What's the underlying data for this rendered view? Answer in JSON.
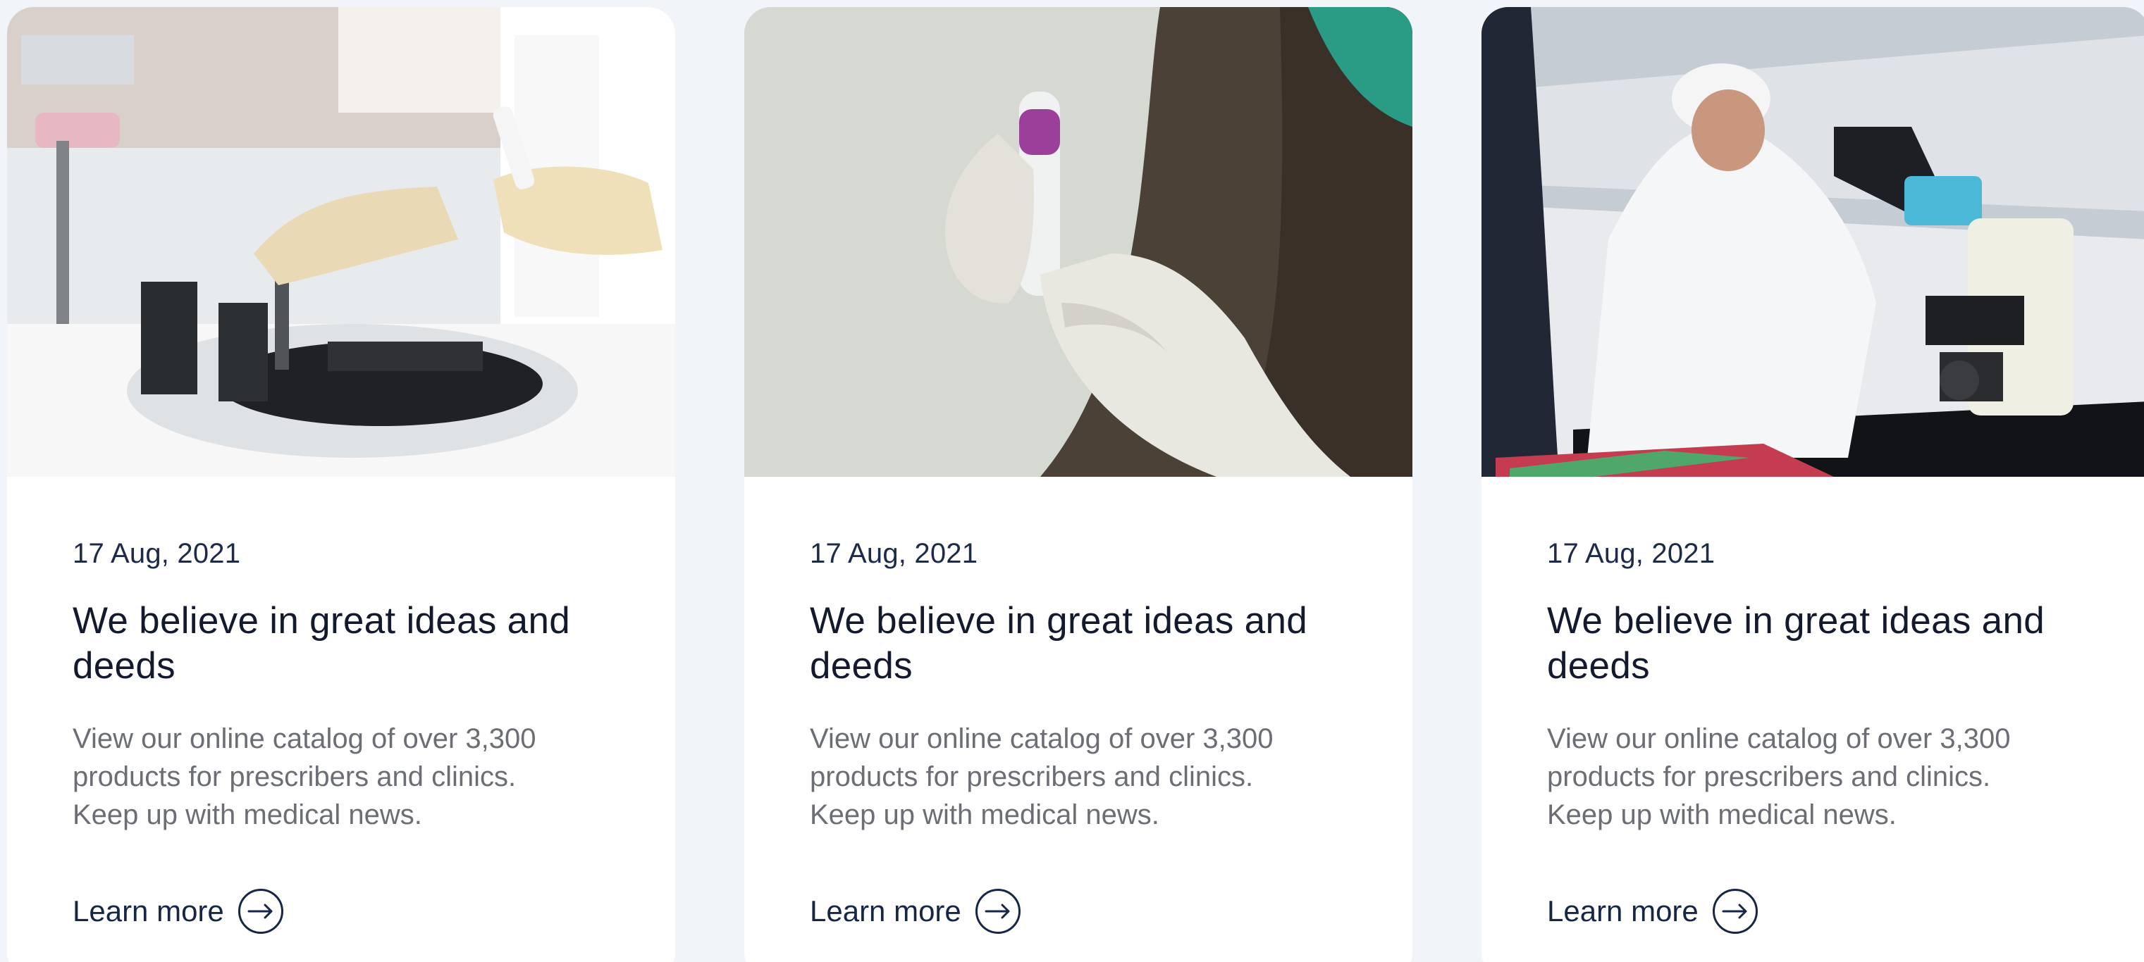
{
  "cards": [
    {
      "date": "17 Aug, 2021",
      "title": "We believe in great ideas and deeds",
      "text": "View our online catalog of over 3,300 products for prescribers and clinics. Keep up with medical news.",
      "link_label": "Learn more",
      "image_icon": "laboratory-centrifuge-photo-icon",
      "link_icon": "arrow-right-circle-icon"
    },
    {
      "date": "17 Aug, 2021",
      "title": "We believe in great ideas and deeds",
      "text": "View our online catalog of over 3,300 products for prescribers and clinics. Keep up with medical news.",
      "link_label": "Learn more",
      "image_icon": "test-tube-photo-icon",
      "link_icon": "arrow-right-circle-icon"
    },
    {
      "date": "17 Aug, 2021",
      "title": "We believe in great ideas and deeds",
      "text": "View our online catalog of over 3,300 products for prescribers and clinics. Keep up with medical news.",
      "link_label": "Learn more",
      "image_icon": "microscope-photo-icon",
      "link_icon": "arrow-right-circle-icon"
    }
  ],
  "colors": {
    "page_background": "#f1f4f8",
    "card_background": "#ffffff",
    "primary_text": "#141a2e",
    "date_text": "#1d2a4a",
    "muted_text": "#6b6e75",
    "link": "#172647"
  }
}
